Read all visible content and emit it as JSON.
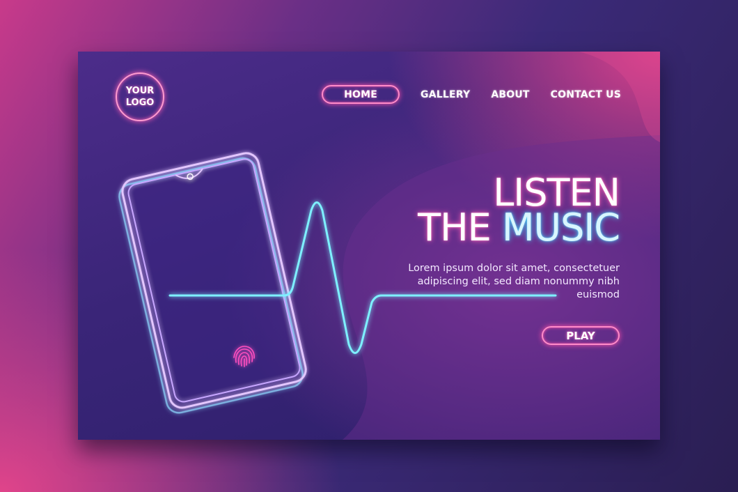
{
  "logo": {
    "line1": "YOUR",
    "line2": "LOGO"
  },
  "nav": {
    "items": [
      {
        "label": "HOME",
        "active": true
      },
      {
        "label": "GALLERY"
      },
      {
        "label": "ABOUT"
      },
      {
        "label": "CONTACT US"
      }
    ]
  },
  "hero": {
    "title_line1": "LISTEN",
    "title_line2_a": "THE",
    "title_line2_b": "MUSIC",
    "description": "Lorem ipsum dolor sit amet, consectetuer adipiscing elit, sed diam nonummy nibh euismod",
    "play_label": "PLAY"
  },
  "colors": {
    "neon_pink": "#ff5fb5",
    "neon_cyan": "#3fd3ff",
    "phone_outline": "#b89cff"
  },
  "icons": {
    "phone": "smartphone-icon",
    "fingerprint": "fingerprint-icon",
    "heartbeat": "heartbeat-line-icon"
  }
}
